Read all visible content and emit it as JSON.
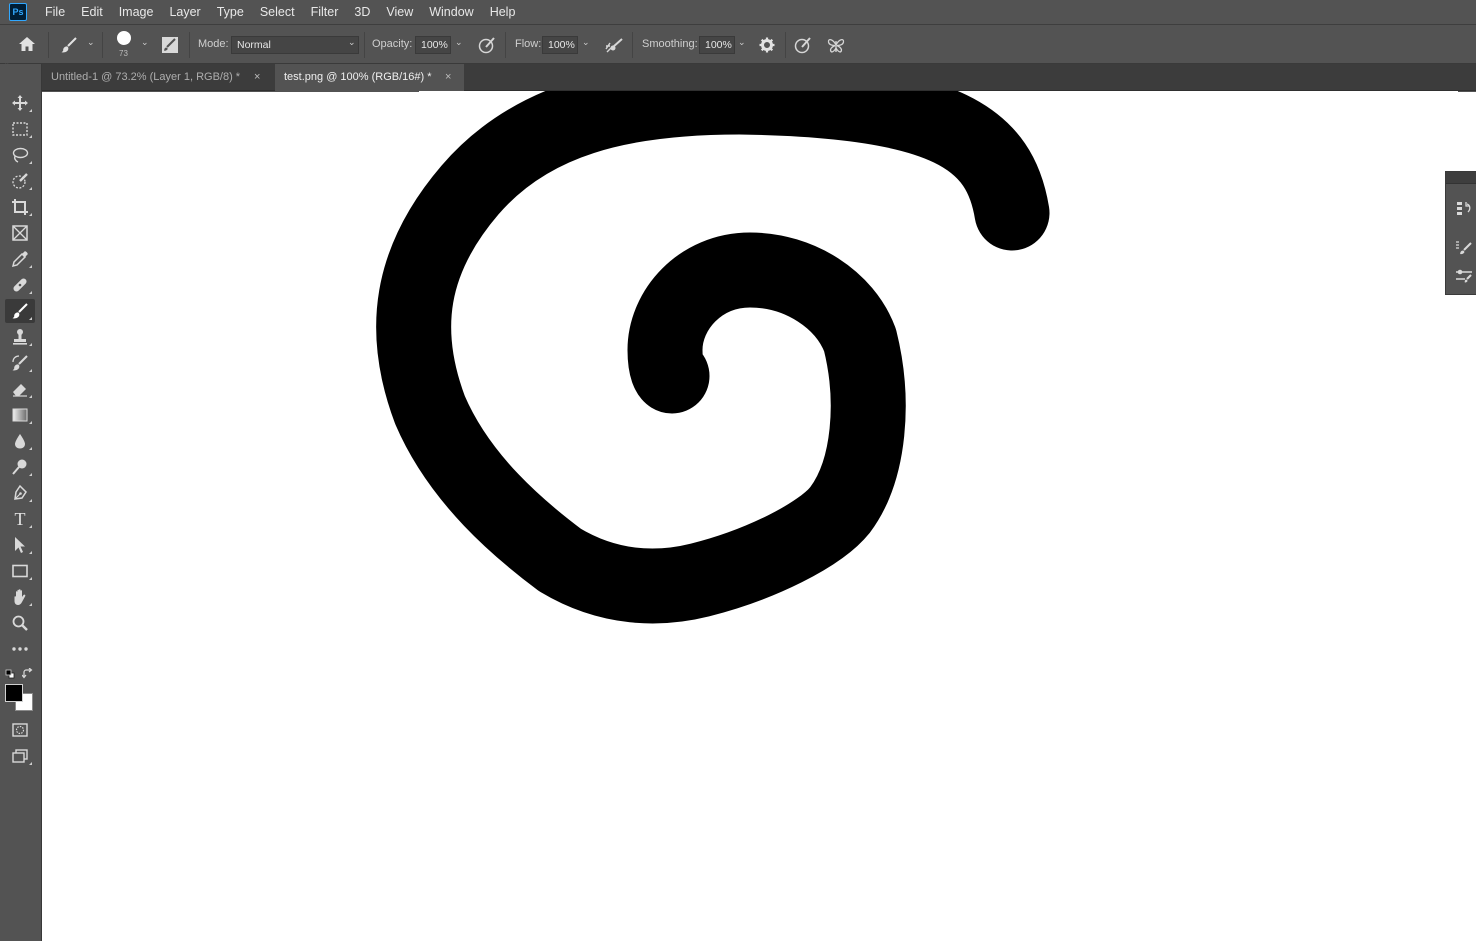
{
  "app": {
    "logo": "Ps"
  },
  "menu": [
    "File",
    "Edit",
    "Image",
    "Layer",
    "Type",
    "Select",
    "Filter",
    "3D",
    "View",
    "Window",
    "Help"
  ],
  "options": {
    "brush_size": "73",
    "mode_label": "Mode:",
    "mode_value": "Normal",
    "opacity_label": "Opacity:",
    "opacity_value": "100%",
    "flow_label": "Flow:",
    "flow_value": "100%",
    "smoothing_label": "Smoothing:",
    "smoothing_value": "100%"
  },
  "tabs": [
    {
      "label": "Untitled-1 @ 73.2% (Layer 1, RGB/8) *",
      "close": "×",
      "active": false
    },
    {
      "label": "test.png @ 100% (RGB/16#) *",
      "close": "×",
      "active": true
    }
  ],
  "collapse_glyph": "»",
  "tools": [
    "move-tool",
    "marquee-tool",
    "lasso-tool",
    "quick-selection-tool",
    "crop-tool",
    "frame-tool",
    "eyedropper-tool",
    "healing-brush-tool",
    "brush-tool",
    "clone-stamp-tool",
    "history-brush-tool",
    "eraser-tool",
    "gradient-tool",
    "blur-tool",
    "dodge-tool",
    "pen-tool",
    "type-tool",
    "path-selection-tool",
    "rectangle-tool",
    "hand-tool",
    "zoom-tool",
    "edit-toolbar"
  ],
  "type_tool_glyph": "T",
  "colors": {
    "foreground": "#000000",
    "background": "#ffffff",
    "ui_bg": "#535353",
    "canvas": "#ffffff",
    "stroke": "#000000"
  }
}
